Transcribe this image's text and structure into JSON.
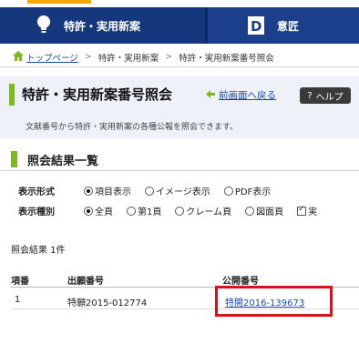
{
  "nav": {
    "tabs": [
      {
        "label": "特許・実用新案",
        "icon": "lightbulb-icon"
      },
      {
        "label": "意匠",
        "icon": "design-d-icon"
      }
    ]
  },
  "breadcrumb": {
    "home": "トップページ",
    "items": [
      "特許・実用新案",
      "特許・実用新案番号照会"
    ]
  },
  "page": {
    "title": "特許・実用新案番号照会",
    "back_label": "前画面へ戻る",
    "help_label": "ヘルプ",
    "description": "文献番号から特許・実用新案の各種公報を照会できます。"
  },
  "results": {
    "section_title": "照会結果一覧",
    "display_format": {
      "label": "表示形式",
      "options": [
        "項目表示",
        "イメージ表示",
        "PDF表示"
      ],
      "selected": 0
    },
    "display_type": {
      "label": "表示種別",
      "options": [
        "全頁",
        "第1頁",
        "クレーム頁",
        "図面頁"
      ],
      "selected": 0,
      "checkbox_label": "実"
    },
    "count_text": "照会結果 1件",
    "columns": [
      "項番",
      "出願番号",
      "公開番号"
    ],
    "rows": [
      {
        "no": "1",
        "application": "特願2015-012774",
        "publication": "特開2016-139673"
      }
    ]
  },
  "colors": {
    "nav": "#1c3f8c",
    "accent_green": "#7dba20",
    "link": "#1a4aa8",
    "highlight": "#d6121c"
  }
}
